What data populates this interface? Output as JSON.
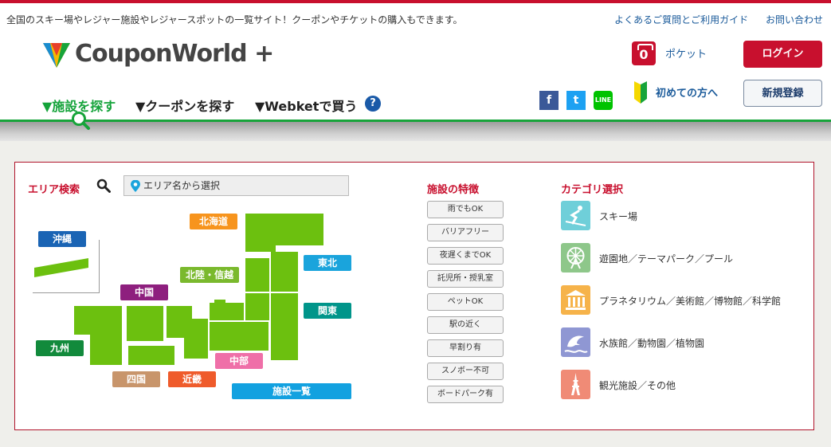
{
  "header": {
    "tagline": "全国のスキー場やレジャー施設やレジャースポットの一覧サイト！クーポンやチケットの購入もできます。",
    "faq_link": "よくあるご質問とご利用ガイド",
    "contact_link": "お問い合わせ",
    "logo_text": "CouponWorld",
    "logo_plus": "+",
    "pocket_label": "ポケット",
    "pocket_count": "0",
    "login_label": "ログイン",
    "beginner_label": "初めての方へ",
    "register_label": "新規登録",
    "social": {
      "facebook": "f",
      "twitter": "t",
      "line": "LINE"
    }
  },
  "nav": {
    "facility": "▼施設を探す",
    "coupon": "▼クーポンを探す",
    "webket": "▼Webketで買う",
    "help": "?"
  },
  "area": {
    "title": "エリア検索",
    "placeholder": "エリア名から選択",
    "regions": {
      "okinawa": "沖縄",
      "hokkaido": "北海道",
      "tohoku": "東北",
      "hokuriku": "北陸・信越",
      "chugoku": "中国",
      "kanto": "関東",
      "kyushu": "九州",
      "chubu": "中部",
      "shikoku": "四国",
      "kinki": "近畿",
      "all": "施設一覧"
    },
    "colors": {
      "okinawa": "#1a64b4",
      "hokkaido": "#f7941d",
      "tohoku": "#1aa4dc",
      "hokuriku": "#7ab92d",
      "chugoku": "#8e1f7e",
      "kanto": "#00958a",
      "kyushu": "#128a3c",
      "chubu": "#ef6fa8",
      "shikoku": "#c8956b",
      "kinki": "#ef5b2b",
      "all": "#12a1e0"
    }
  },
  "features": {
    "title": "施設の特徴",
    "items": [
      "雨でもOK",
      "バリアフリー",
      "夜遅くまでOK",
      "託児所・授乳室",
      "ペットOK",
      "駅の近く",
      "早割り有",
      "スノボー不可",
      "ボードパーク有"
    ]
  },
  "categories": {
    "title": "カテゴリ選択",
    "items": [
      {
        "label": "スキー場",
        "icon": "ski-icon",
        "color": "#6fcfd9"
      },
      {
        "label": "遊園地／テーマパーク／プール",
        "icon": "ferris-wheel-icon",
        "color": "#8ec78a"
      },
      {
        "label": "プラネタリウム／美術館／博物館／科学館",
        "icon": "museum-icon",
        "color": "#f6b34a"
      },
      {
        "label": "水族館／動物園／植物園",
        "icon": "dolphin-icon",
        "color": "#8f97d3"
      },
      {
        "label": "観光施設／その他",
        "icon": "tower-icon",
        "color": "#f08b76"
      }
    ]
  }
}
